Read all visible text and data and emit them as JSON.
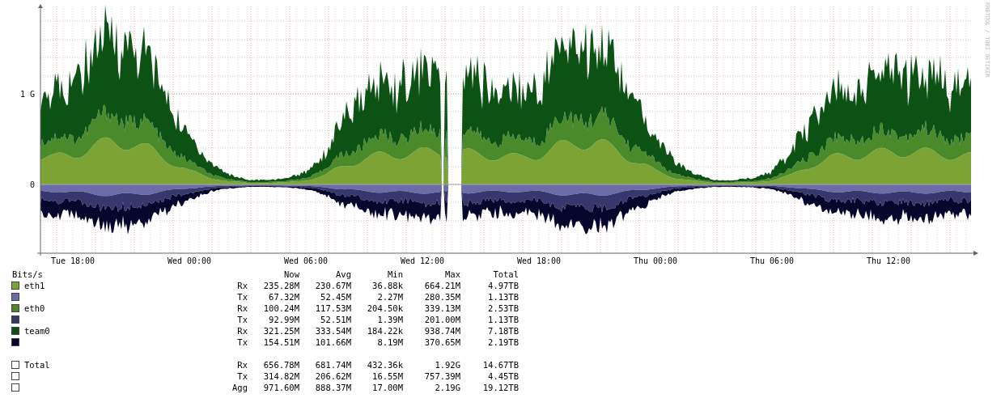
{
  "chart": {
    "y_labels": [
      "1 G",
      "0"
    ],
    "x_labels": [
      "Tue 18:00",
      "Wed 00:00",
      "Wed 06:00",
      "Wed 12:00",
      "Wed 18:00",
      "Thu 00:00",
      "Thu 06:00",
      "Thu 12:00"
    ],
    "credit": "RRDTOOL / TOBI OETIKER"
  },
  "legend": {
    "unit": "Bits/s",
    "columns": [
      "Now",
      "Avg",
      "Min",
      "Max",
      "Total"
    ],
    "rows": [
      {
        "name": "eth1",
        "direction": "Rx",
        "color": "#7ba434",
        "values": [
          "235.28M",
          "230.67M",
          "36.88k",
          "664.21M",
          "4.97TB"
        ]
      },
      {
        "direction": "Tx",
        "color": "#6c6caa",
        "values": [
          "67.32M",
          "52.45M",
          "2.27M",
          "280.35M",
          "1.13TB"
        ]
      },
      {
        "name": "eth0",
        "direction": "Rx",
        "color": "#4a8a2a",
        "values": [
          "100.24M",
          "117.53M",
          "204.50k",
          "339.13M",
          "2.53TB"
        ]
      },
      {
        "direction": "Tx",
        "color": "#37376e",
        "values": [
          "92.99M",
          "52.51M",
          "1.39M",
          "201.00M",
          "1.13TB"
        ]
      },
      {
        "name": "team0",
        "direction": "Rx",
        "color": "#0b5214",
        "values": [
          "321.25M",
          "333.54M",
          "184.22k",
          "938.74M",
          "7.18TB"
        ]
      },
      {
        "direction": "Tx",
        "color": "#07072e",
        "values": [
          "154.51M",
          "101.66M",
          "8.19M",
          "370.65M",
          "2.19TB"
        ]
      }
    ],
    "total_rows": [
      {
        "name": "Total",
        "direction": "Rx",
        "values": [
          "656.78M",
          "681.74M",
          "432.36k",
          "1.92G",
          "14.67TB"
        ]
      },
      {
        "direction": "Tx",
        "values": [
          "314.82M",
          "206.62M",
          "16.55M",
          "757.39M",
          "4.45TB"
        ]
      },
      {
        "direction": "Agg",
        "values": [
          "971.60M",
          "888.37M",
          "17.00M",
          "2.19G",
          "19.12TB"
        ]
      }
    ]
  }
}
